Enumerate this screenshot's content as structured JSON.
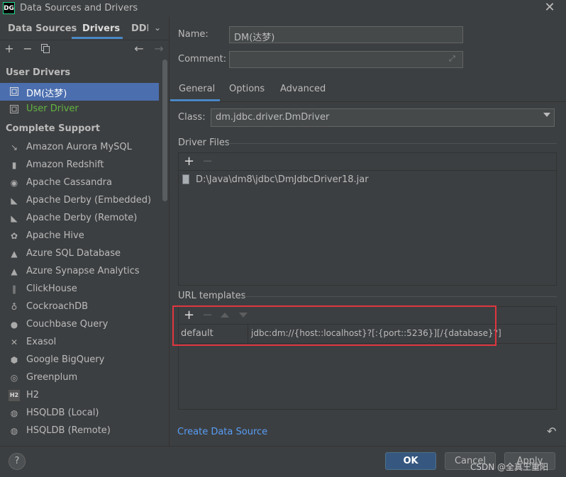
{
  "window": {
    "title": "Data Sources and Drivers",
    "logo": "DG"
  },
  "left_tabs": [
    "Data Sources",
    "Drivers",
    "DDI"
  ],
  "toolbar": {
    "add": "+",
    "remove": "−",
    "back": "←",
    "forward": "→"
  },
  "sections": {
    "user_drivers": "User Drivers",
    "complete_support": "Complete Support"
  },
  "user_drivers": [
    {
      "label": "DM(达梦)",
      "icon": "driver-icon"
    },
    {
      "label": "User Driver",
      "icon": "driver-icon"
    }
  ],
  "drivers": [
    {
      "label": "Amazon Aurora MySQL",
      "icon": "aurora-icon",
      "glyph": "↘"
    },
    {
      "label": "Amazon Redshift",
      "icon": "redshift-icon",
      "glyph": "▮"
    },
    {
      "label": "Apache Cassandra",
      "icon": "cassandra-icon",
      "glyph": "◉"
    },
    {
      "label": "Apache Derby (Embedded)",
      "icon": "derby-icon",
      "glyph": "◣"
    },
    {
      "label": "Apache Derby (Remote)",
      "icon": "derby-icon",
      "glyph": "◣"
    },
    {
      "label": "Apache Hive",
      "icon": "hive-icon",
      "glyph": "✿"
    },
    {
      "label": "Azure SQL Database",
      "icon": "azure-icon",
      "glyph": "▲"
    },
    {
      "label": "Azure Synapse Analytics",
      "icon": "azure-icon",
      "glyph": "▲"
    },
    {
      "label": "ClickHouse",
      "icon": "clickhouse-icon",
      "glyph": "∥"
    },
    {
      "label": "CockroachDB",
      "icon": "cockroach-icon",
      "glyph": "♁"
    },
    {
      "label": "Couchbase Query",
      "icon": "couchbase-icon",
      "glyph": "●"
    },
    {
      "label": "Exasol",
      "icon": "exasol-icon",
      "glyph": "✕"
    },
    {
      "label": "Google BigQuery",
      "icon": "bigquery-icon",
      "glyph": "⬢"
    },
    {
      "label": "Greenplum",
      "icon": "greenplum-icon",
      "glyph": "◎"
    },
    {
      "label": "H2",
      "icon": "h2-icon",
      "glyph": "H2"
    },
    {
      "label": "HSQLDB (Local)",
      "icon": "hsqldb-icon",
      "glyph": "◍"
    },
    {
      "label": "HSQLDB (Remote)",
      "icon": "hsqldb-icon",
      "glyph": "◍"
    }
  ],
  "form": {
    "name_label": "Name:",
    "name_value": "DM(达梦)",
    "comment_label": "Comment:",
    "comment_value": ""
  },
  "right_tabs": [
    "General",
    "Options",
    "Advanced"
  ],
  "general": {
    "class_label": "Class:",
    "class_value": "dm.jdbc.driver.DmDriver",
    "driver_files_title": "Driver Files",
    "driver_file": "D:\\Java\\dm8\\jdbc\\DmJdbcDriver18.jar",
    "url_templates_title": "URL templates",
    "url_templates": [
      {
        "name": "default",
        "template": "jdbc:dm://{host::localhost}?[:{port::5236}][/{database}?]"
      }
    ]
  },
  "create_link": "Create Data Source",
  "buttons": {
    "help": "?",
    "ok": "OK",
    "cancel": "Cancel",
    "apply": "Apply"
  },
  "watermark": "CSDN @全真王重阳",
  "colors": {
    "accent": "#4a88c7",
    "selection": "#4b6eaf",
    "highlight_border": "#e0363f",
    "link": "#589df6",
    "green": "#62b543"
  }
}
